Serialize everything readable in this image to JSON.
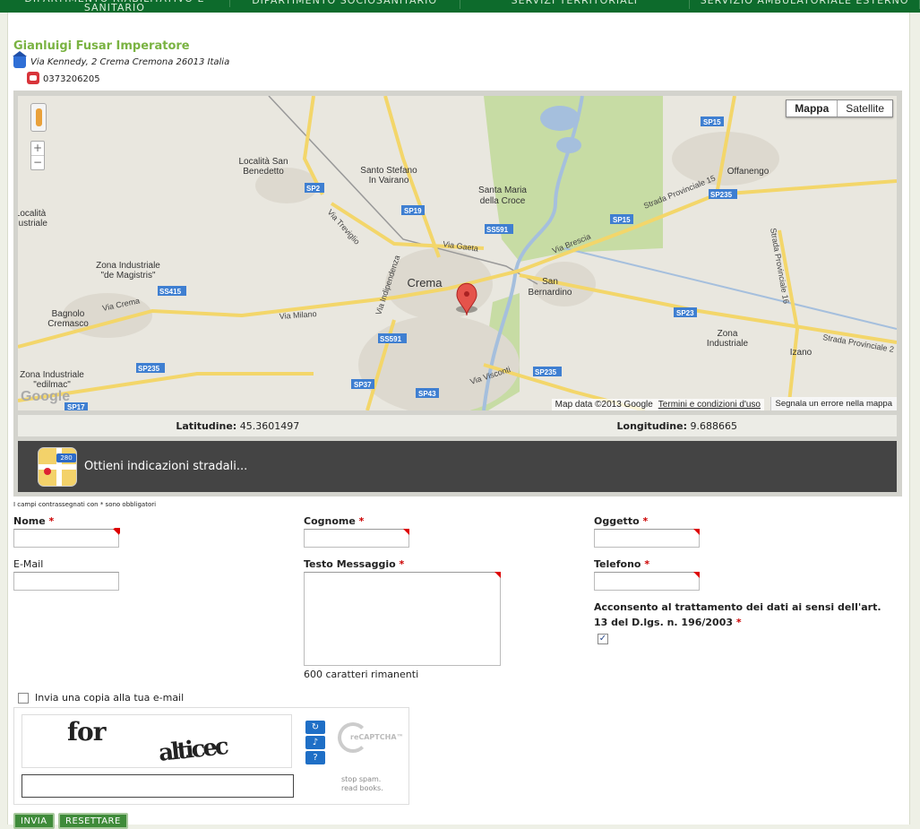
{
  "nav": {
    "tabs": [
      "DIPARTIMENTO RIABILITATIVO E SANITARIO",
      "DIPARTIMENTO SOCIOSANITARIO",
      "SERVIZI TERRITORIALI",
      "SERVIZIO AMBULATORIALE ESTERNO"
    ]
  },
  "header": {
    "name": "Gianluigi Fusar Imperatore",
    "address": "Via Kennedy, 2 Crema Cremona 26013 Italia",
    "phone": "0373206205"
  },
  "map": {
    "type_buttons": [
      "Mappa",
      "Satellite"
    ],
    "zoom_in": "+",
    "zoom_out": "−",
    "attribution": "Map data ©2013 Google",
    "terms": "Termini e condizioni d'uso",
    "report": "Segnala un errore nella mappa",
    "logo": "Google",
    "places": [
      "Località San Benedetto",
      "Santo Stefano In Vairano",
      "Santa Maria della Croce",
      "Offanengo",
      "Località ... dustriale",
      "Zona Industriale \"de Magistris\"",
      "Crema",
      "San Bernardino",
      "Bagnolo Cremasco",
      "Zona Industriale",
      "Izano",
      "Zona Industriale \"edilmac\""
    ],
    "roads": [
      "Via Treviglio",
      "Via Gaeta",
      "Via Brescia",
      "Strada Provinciale 15",
      "Strada Provinciale 16",
      "Strada Provinciale 2",
      "Via Crema",
      "Via Milano",
      "Via Indipendenza",
      "Via Visconti"
    ],
    "shields": [
      "SP15",
      "SP2",
      "SP19",
      "SS591",
      "SP15",
      "SP235",
      "SS415",
      "SP23",
      "SS591",
      "SP235",
      "SP37",
      "SP43",
      "SP235",
      "SP17"
    ]
  },
  "coords": {
    "lat_label": "Latitudine:",
    "lat_value": "45.3601497",
    "lon_label": "Longitudine:",
    "lon_value": "9.688665"
  },
  "directions": {
    "label": "Ottieni indicazioni stradali...",
    "icon_badge": "280"
  },
  "form": {
    "required_note": "I campi contrassegnati con * sono obbligatori",
    "nome_label": "Nome",
    "cognome_label": "Cognome",
    "oggetto_label": "Oggetto",
    "email_label": "E-Mail",
    "testo_label": "Testo Messaggio",
    "telefono_label": "Telefono",
    "counter": "600 caratteri rimanenti",
    "consent": "Acconsento al trattamento dei dati ai sensi dell'art. 13 del D.lgs. n. 196/2003",
    "consent_checked": true,
    "copy_label": "Invia una copia alla tua e-mail",
    "star": "*"
  },
  "captcha": {
    "word1": "for",
    "word2": "alticec",
    "brand": "reCAPTCHA™",
    "tagline1": "stop spam.",
    "tagline2": "read books.",
    "refresh_icon": "refresh-icon",
    "audio_icon": "audio-icon",
    "help_icon": "help-icon"
  },
  "buttons": {
    "submit": "INVIA",
    "reset": "RESETTARE"
  }
}
